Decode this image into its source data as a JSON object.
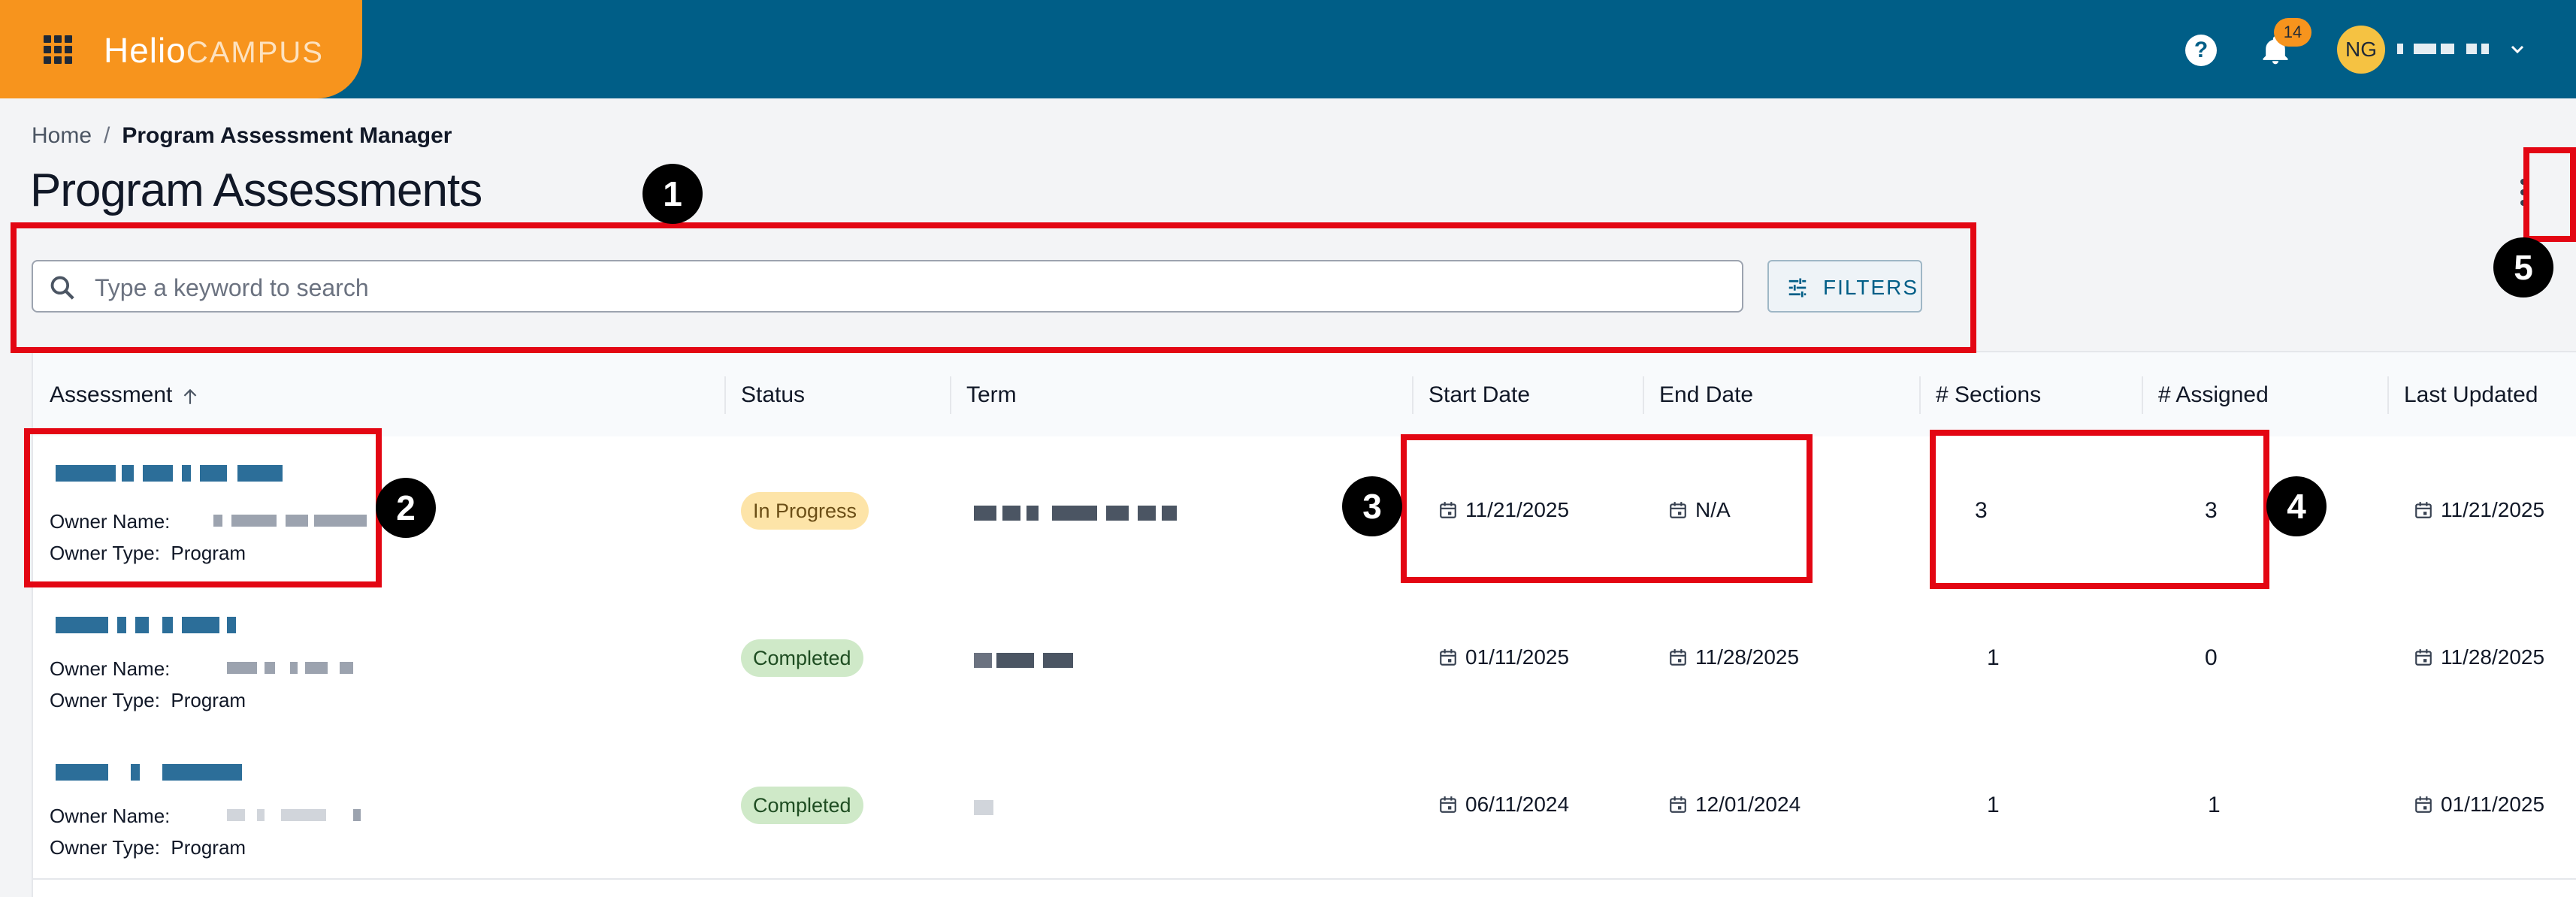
{
  "header": {
    "brand_bold": "Helio",
    "brand_light": "CAMPUS",
    "help_glyph": "?",
    "notification_count": "14",
    "user_initials": "NG",
    "colors": {
      "bar": "#005e87",
      "brand": "#f7941d"
    }
  },
  "breadcrumb": {
    "home": "Home",
    "separator": "/",
    "current": "Program Assessment Manager"
  },
  "page_title": "Program Assessments",
  "search": {
    "placeholder": "Type a keyword to search",
    "value": ""
  },
  "filters_label": "FILTERS",
  "table": {
    "columns": [
      "Assessment",
      "Status",
      "Term",
      "Start Date",
      "End Date",
      "# Sections",
      "# Assigned",
      "Last Updated"
    ],
    "owner_name_label": "Owner Name:",
    "owner_type_label": "Owner Type:",
    "rows": [
      {
        "owner_type": "Program",
        "status": "In Progress",
        "start": "11/21/2025",
        "end": "N/A",
        "sections": "3",
        "assigned": "3",
        "updated": "11/21/2025"
      },
      {
        "owner_type": "Program",
        "status": "Completed",
        "start": "01/11/2025",
        "end": "11/28/2025",
        "sections": "1",
        "assigned": "0",
        "updated": "11/28/2025"
      },
      {
        "owner_type": "Program",
        "status": "Completed",
        "start": "06/11/2024",
        "end": "12/01/2024",
        "sections": "1",
        "assigned": "1",
        "updated": "01/11/2025"
      }
    ]
  },
  "annotations": {
    "markers": [
      "1",
      "2",
      "3",
      "4",
      "5"
    ],
    "highlight_color": "#e30613"
  }
}
